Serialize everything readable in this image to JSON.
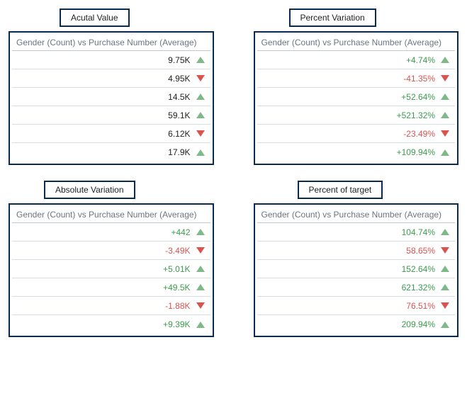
{
  "header_text": "Gender (Count) vs Purchase Number (Average)",
  "panels": [
    {
      "title": "Acutal Value",
      "rows": [
        {
          "value": "9.75K",
          "direction": "up",
          "color_value": false
        },
        {
          "value": "4.95K",
          "direction": "down",
          "color_value": false
        },
        {
          "value": "14.5K",
          "direction": "up",
          "color_value": false
        },
        {
          "value": "59.1K",
          "direction": "up",
          "color_value": false
        },
        {
          "value": "6.12K",
          "direction": "down",
          "color_value": false
        },
        {
          "value": "17.9K",
          "direction": "up",
          "color_value": false
        }
      ]
    },
    {
      "title": "Percent Variation",
      "rows": [
        {
          "value": "+4.74%",
          "direction": "up",
          "color_value": true
        },
        {
          "value": "-41.35%",
          "direction": "down",
          "color_value": true
        },
        {
          "value": "+52.64%",
          "direction": "up",
          "color_value": true
        },
        {
          "value": "+521.32%",
          "direction": "up",
          "color_value": true
        },
        {
          "value": "-23.49%",
          "direction": "down",
          "color_value": true
        },
        {
          "value": "+109.94%",
          "direction": "up",
          "color_value": true
        }
      ]
    },
    {
      "title": "Absolute Variation",
      "rows": [
        {
          "value": "+442",
          "direction": "up",
          "color_value": true
        },
        {
          "value": "-3.49K",
          "direction": "down",
          "color_value": true
        },
        {
          "value": "+5.01K",
          "direction": "up",
          "color_value": true
        },
        {
          "value": "+49.5K",
          "direction": "up",
          "color_value": true
        },
        {
          "value": "-1.88K",
          "direction": "down",
          "color_value": true
        },
        {
          "value": "+9.39K",
          "direction": "up",
          "color_value": true
        }
      ]
    },
    {
      "title": "Percent of target",
      "rows": [
        {
          "value": "104.74%",
          "direction": "up",
          "color_value": true
        },
        {
          "value": "58.65%",
          "direction": "down",
          "color_value": true
        },
        {
          "value": "152.64%",
          "direction": "up",
          "color_value": true
        },
        {
          "value": "621.32%",
          "direction": "up",
          "color_value": true
        },
        {
          "value": "76.51%",
          "direction": "down",
          "color_value": true
        },
        {
          "value": "209.94%",
          "direction": "up",
          "color_value": true
        }
      ]
    }
  ],
  "chart_data": [
    {
      "type": "table",
      "title": "Acutal Value",
      "subtitle": "Gender (Count) vs Purchase Number (Average)",
      "values": [
        9750,
        4950,
        14500,
        59100,
        6120,
        17900
      ],
      "directions": [
        "up",
        "down",
        "up",
        "up",
        "down",
        "up"
      ]
    },
    {
      "type": "table",
      "title": "Percent Variation",
      "subtitle": "Gender (Count) vs Purchase Number (Average)",
      "values": [
        4.74,
        -41.35,
        52.64,
        521.32,
        -23.49,
        109.94
      ],
      "unit": "%",
      "directions": [
        "up",
        "down",
        "up",
        "up",
        "down",
        "up"
      ]
    },
    {
      "type": "table",
      "title": "Absolute Variation",
      "subtitle": "Gender (Count) vs Purchase Number (Average)",
      "values": [
        442,
        -3490,
        5010,
        49500,
        -1880,
        9390
      ],
      "directions": [
        "up",
        "down",
        "up",
        "up",
        "down",
        "up"
      ]
    },
    {
      "type": "table",
      "title": "Percent of target",
      "subtitle": "Gender (Count) vs Purchase Number (Average)",
      "values": [
        104.74,
        58.65,
        152.64,
        621.32,
        76.51,
        209.94
      ],
      "unit": "%",
      "directions": [
        "up",
        "down",
        "up",
        "up",
        "down",
        "up"
      ]
    }
  ]
}
